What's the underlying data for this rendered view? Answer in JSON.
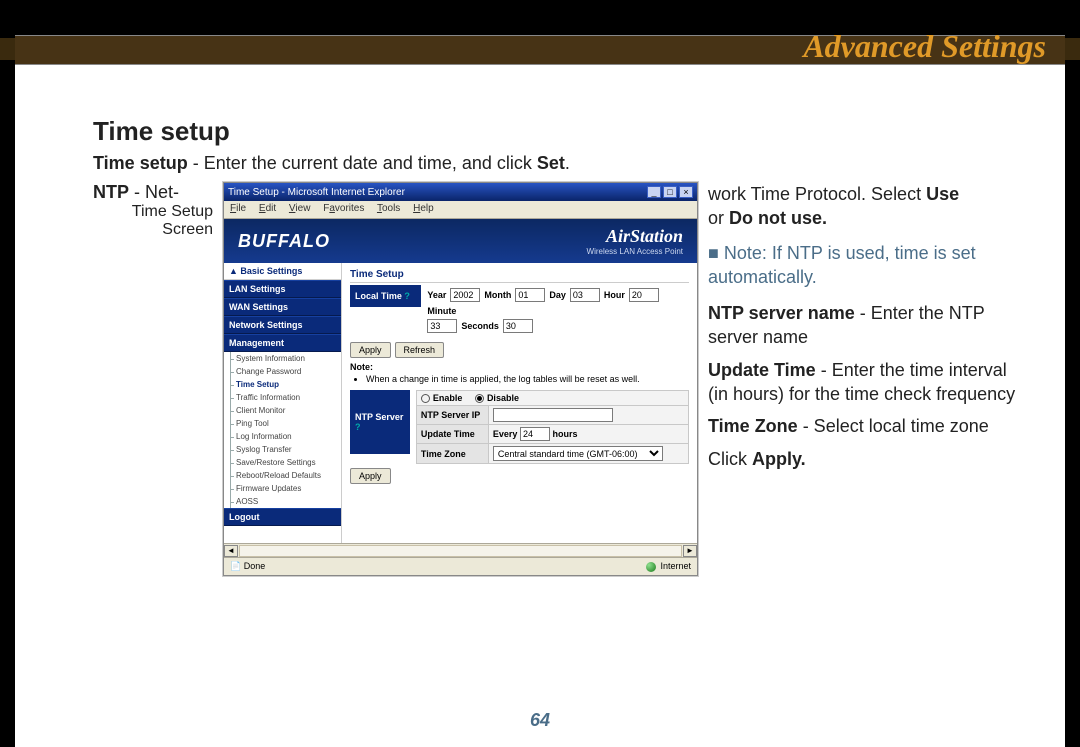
{
  "header": {
    "title": "Advanced Settings"
  },
  "section": {
    "heading": "Time setup",
    "intro_prefix": "Time setup",
    "intro_rest": " - Enter the current date and time, and click ",
    "intro_bold_end": "Set",
    "intro_period": "."
  },
  "left": {
    "ntp_label": "NTP",
    "ntp_rest": " - Net-",
    "caption_line1": "Time Setup",
    "caption_line2": "Screen"
  },
  "right": {
    "line1_a": "work Time Protocol. Select ",
    "line1_b": "Use",
    "line2_a": "or ",
    "line2_b": "Do not use.",
    "note": "■ Note: If NTP is used, time is set automatically.",
    "ntpserver_b": "NTP server name",
    "ntpserver_rest": " - Enter the NTP server name",
    "update_b": "Update Time",
    "update_rest": " - Enter the time interval (in hours) for the time check frequency",
    "tz_b": "Time Zone",
    "tz_rest": " - Select local time zone",
    "click": "Click ",
    "apply": "Apply."
  },
  "page_number": "64",
  "screenshot": {
    "window_title": "Time Setup - Microsoft Internet Explorer",
    "menus": [
      "File",
      "Edit",
      "View",
      "Favorites",
      "Tools",
      "Help"
    ],
    "brand_left": "BUFFALO",
    "brand_right_top": "AirStation",
    "brand_right_sub": "Wireless LAN Access Point",
    "nav": {
      "basic": "▲ Basic Settings",
      "lan": "LAN Settings",
      "wan": "WAN Settings",
      "net": "Network Settings",
      "mgmt": "Management",
      "subs": [
        "System Information",
        "Change Password",
        "Time Setup",
        "Traffic Information",
        "Client Monitor",
        "Ping Tool",
        "Log Information",
        "Syslog Transfer",
        "Save/Restore Settings",
        "Reboot/Reload Defaults",
        "Firmware Updates",
        "AOSS"
      ],
      "active_index": 2,
      "logout": "Logout"
    },
    "main": {
      "heading": "Time Setup",
      "local_time": "Local Time",
      "year_l": "Year",
      "year_v": "2002",
      "month_l": "Month",
      "month_v": "01",
      "day_l": "Day",
      "day_v": "03",
      "hour_l": "Hour",
      "hour_v": "20",
      "minute_l": "Minute",
      "minute_v": "33",
      "seconds_l": "Seconds",
      "seconds_v": "30",
      "apply": "Apply",
      "refresh": "Refresh",
      "note_h": "Note:",
      "note_item": "When a change in time is applied, the log tables will be reset as well.",
      "ntp_server": "NTP Server",
      "enable": "Enable",
      "disable": "Disable",
      "ntp_ip": "NTP Server IP",
      "update_time": "Update Time",
      "every": "Every",
      "update_v": "24",
      "hours": "hours",
      "time_zone": "Time Zone",
      "tz_value": "Central standard time (GMT-06:00)"
    },
    "status_left": "Done",
    "status_right": "Internet"
  }
}
